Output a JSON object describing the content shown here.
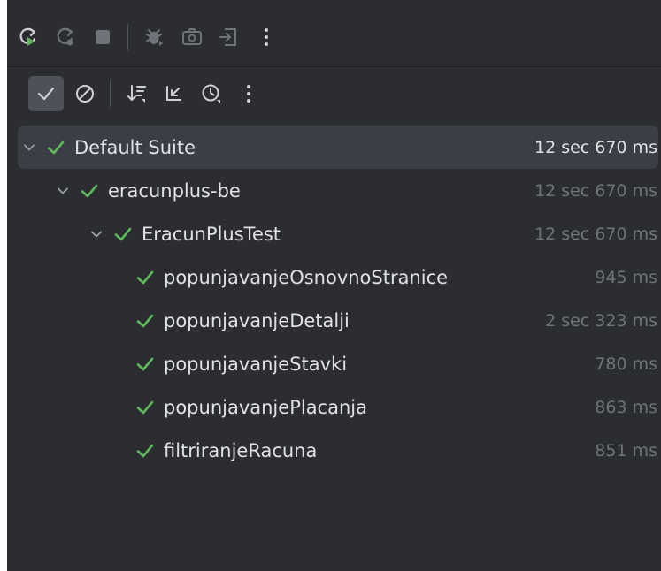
{
  "colors": {
    "panel_bg": "#2b2d30",
    "selected_row": "#3b3e44",
    "pass_green": "#5fb85c",
    "text": "#dfe1e5",
    "muted": "#6f737a",
    "icon": "#ced0d6",
    "icon_disabled": "#6f737a"
  },
  "toolbar_top": [
    {
      "icon": "rerun-icon"
    },
    {
      "icon": "rerun-failed-icon"
    },
    {
      "icon": "stop-icon"
    },
    {
      "icon": "debug-icon"
    },
    {
      "icon": "screenshot-icon"
    },
    {
      "icon": "export-icon"
    },
    {
      "icon": "more-vertical-icon"
    }
  ],
  "toolbar_filter": [
    {
      "icon": "show-passed-icon",
      "active": true
    },
    {
      "icon": "show-ignored-icon"
    },
    {
      "icon": "sort-icon"
    },
    {
      "icon": "collapse-icon"
    },
    {
      "icon": "history-icon"
    },
    {
      "icon": "more-vertical-icon"
    }
  ],
  "tree": [
    {
      "name": "Default Suite",
      "time": "12 sec 670 ms",
      "status": "passed",
      "expanded": true,
      "level": 0,
      "selected": true
    },
    {
      "name": "eracunplus-be",
      "time": "12 sec 670 ms",
      "status": "passed",
      "expanded": true,
      "level": 1
    },
    {
      "name": "EracunPlusTest",
      "time": "12 sec 670 ms",
      "status": "passed",
      "expanded": true,
      "level": 2
    },
    {
      "name": "popunjavanjeOsnovnoStranice",
      "time": "945 ms",
      "status": "passed",
      "level": 3
    },
    {
      "name": "popunjavanjeDetalji",
      "time": "2 sec 323 ms",
      "status": "passed",
      "level": 3
    },
    {
      "name": "popunjavanjeStavki",
      "time": "780 ms",
      "status": "passed",
      "level": 3
    },
    {
      "name": "popunjavanjePlacanja",
      "time": "863 ms",
      "status": "passed",
      "level": 3
    },
    {
      "name": "filtriranjeRacuna",
      "time": "851 ms",
      "status": "passed",
      "level": 3
    }
  ]
}
